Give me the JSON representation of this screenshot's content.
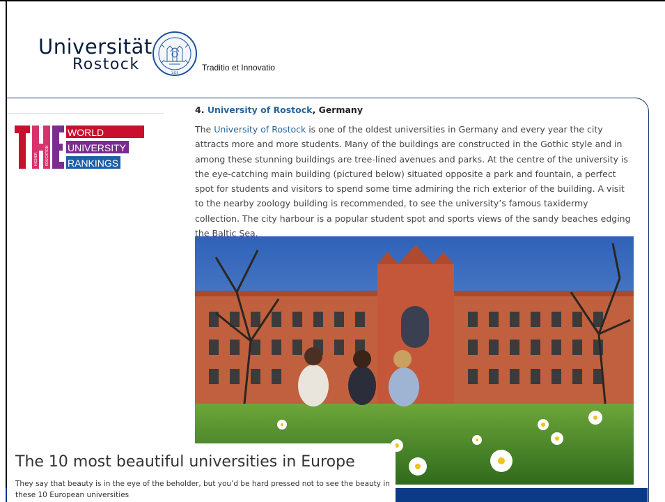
{
  "header": {
    "logo_word1": "Universität",
    "logo_word2": "Rostock",
    "motto": "Traditio et Innovatio",
    "seal_text": "ROSTOCHIENSIS"
  },
  "ranking_logo": {
    "big_letters": "THE",
    "line1": "WORLD",
    "line2": "UNIVERSITY",
    "line3": "RANKINGS",
    "vertical1": "TIMES",
    "vertical2": "HIGHER",
    "vertical3": "EDUCATION"
  },
  "article": {
    "title_prefix": "4.",
    "title_link": "University of Rostock",
    "title_suffix": ", Germany",
    "body_link": "University of Rostock",
    "body_intro": "The ",
    "body_text": " is one of the oldest universities in Germany and every year the city attracts more and more students. Many of the buildings are constructed in the Gothic style and in among these stunning buildings are tree-lined avenues and parks. At the centre of the university is the eye-catching main building (pictured below) situated opposite a park and fountain, a perfect spot for students and visitors to spend some time admiring the rich exterior of the building. A visit to the nearby zoology building is recommended, to see the university’s famous taxidermy collection. The city harbour is a popular student spot and sports views of the sandy beaches edging the Baltic Sea."
  },
  "caption": {
    "title": "The 10 most beautiful universities in Europe",
    "subtitle": "They say that beauty is in the eye of the beholder, but you’d be hard pressed not to see the beauty in these 10 European universities"
  },
  "colors": {
    "navy": "#0b3b86",
    "the_red": "#c8102e",
    "the_magenta": "#d6336c",
    "the_purple": "#7b2d8e",
    "the_blue": "#1d5fa8",
    "link": "#2a6496"
  }
}
